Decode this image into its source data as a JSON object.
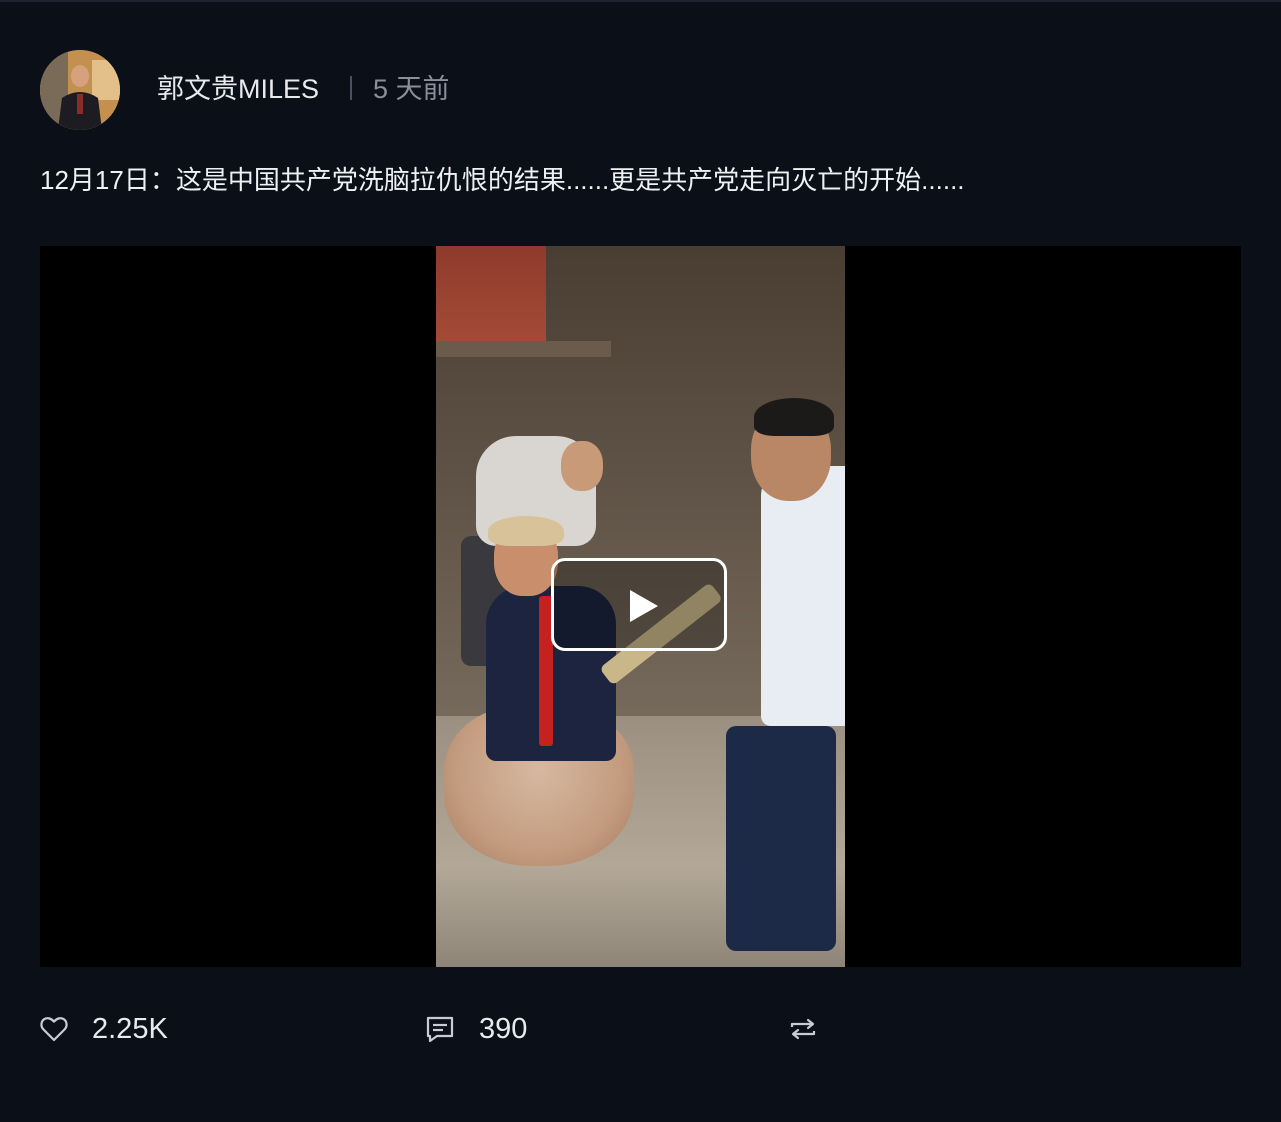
{
  "post": {
    "author": "郭文贵MILES",
    "time": "5 天前",
    "text": "12月17日：这是中国共产党洗脑拉仇恨的结果......更是共产党走向灭亡的开始......"
  },
  "actions": {
    "like_count": "2.25K",
    "comment_count": "390"
  },
  "icons": {
    "like": "heart-outline-icon",
    "comment": "comment-icon",
    "repost": "repost-icon",
    "play": "play-icon"
  },
  "colors": {
    "background": "#0b0f17",
    "text": "#e8eaee",
    "muted": "#8a8f9c"
  }
}
